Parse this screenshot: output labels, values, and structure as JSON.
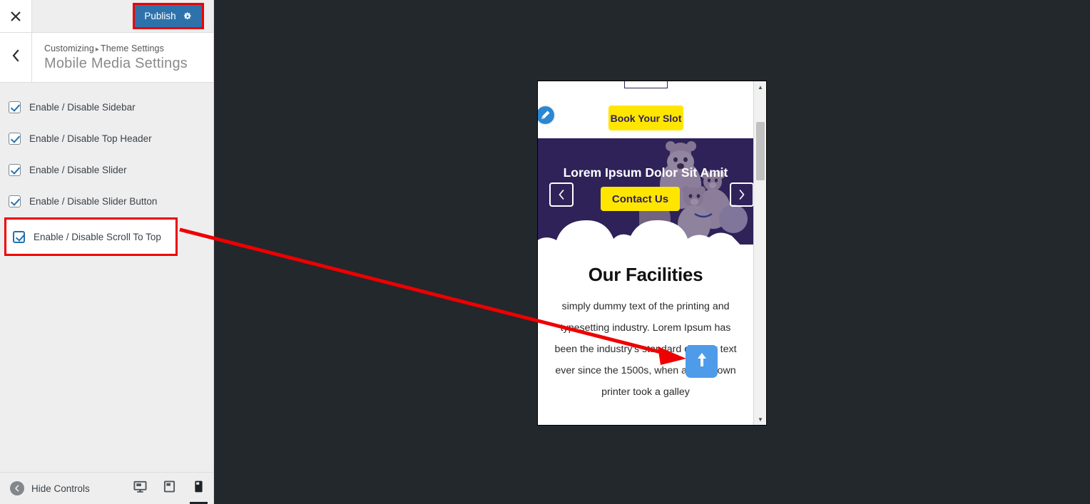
{
  "colors": {
    "accent_blue": "#2e72ac",
    "annotation_red": "#ee0000",
    "site_purple": "#2f2259",
    "site_yellow": "#ffe600",
    "scroll_top_blue": "#4e9bea",
    "checkbox_blue": "#2271b1",
    "preview_backdrop": "#23282d"
  },
  "customizer": {
    "close_icon": "close-icon",
    "publish_label": "Publish",
    "publish_gear_icon": "gear-icon",
    "back_icon": "chevron-left-icon",
    "breadcrumb": {
      "root": "Customizing",
      "separator": "▸",
      "current": "Theme Settings"
    },
    "panel_title": "Mobile Media Settings",
    "controls": [
      {
        "label": "Enable / Disable Sidebar",
        "checked": true
      },
      {
        "label": "Enable / Disable Top Header",
        "checked": true
      },
      {
        "label": "Enable / Disable Slider",
        "checked": true
      },
      {
        "label": "Enable / Disable Slider Button",
        "checked": true
      }
    ],
    "highlighted_control": {
      "label": "Enable / Disable Scroll To Top",
      "checked": true
    },
    "footer": {
      "hide_controls_label": "Hide Controls",
      "hide_controls_icon": "collapse-left-icon",
      "devices": [
        {
          "name": "desktop",
          "icon": "desktop-icon",
          "active": false
        },
        {
          "name": "tablet",
          "icon": "tablet-icon",
          "active": false
        },
        {
          "name": "mobile",
          "icon": "mobile-icon",
          "active": true
        }
      ]
    }
  },
  "preview": {
    "edit_icon": "pencil-edit-icon",
    "book_button_label": "Book Your Slot",
    "slider": {
      "title": "Lorem Ipsum Dolor Sit Amit",
      "contact_button_label": "Contact Us",
      "prev_icon": "chevron-left-icon",
      "next_icon": "chevron-right-icon",
      "prev_glyph": "‹",
      "next_glyph": "›"
    },
    "facilities": {
      "title": "Our Facilities",
      "body": "simply dummy text of the printing and typesetting industry. Lorem Ipsum has been the industry's standard dummy text ever since the 1500s, when an unknown printer took a galley"
    },
    "scroll_top_icon": "arrow-up-icon",
    "scrollbar": {
      "up_glyph": "▲",
      "down_glyph": "▼"
    }
  }
}
